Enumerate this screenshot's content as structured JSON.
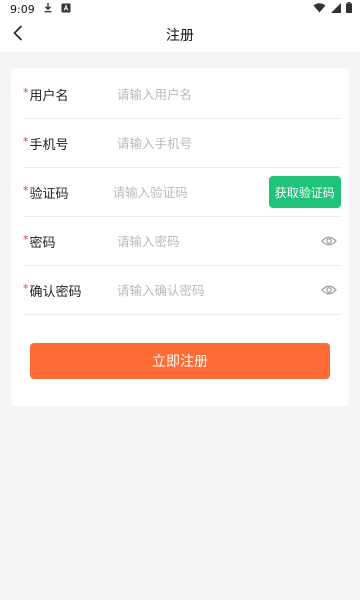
{
  "status_bar": {
    "time": "9:09",
    "icons": [
      "download-icon",
      "notification-icon",
      "wifi-icon",
      "signal-icon",
      "battery-icon"
    ]
  },
  "nav": {
    "title": "注册",
    "back_icon": "chevron-left-icon"
  },
  "form": {
    "required_mark": "*",
    "fields": [
      {
        "label": "用户名",
        "placeholder": "请输入用户名",
        "value": ""
      },
      {
        "label": "手机号",
        "placeholder": "请输入手机号",
        "value": ""
      },
      {
        "label": "验证码",
        "placeholder": "请输入验证码",
        "value": ""
      },
      {
        "label": "密码",
        "placeholder": "请输入密码",
        "value": ""
      },
      {
        "label": "确认密码",
        "placeholder": "请输入确认密码",
        "value": ""
      }
    ],
    "get_code_label": "获取验证码",
    "submit_label": "立即注册"
  },
  "colors": {
    "accent": "#ff6b35",
    "code_button": "#21c27a",
    "required": "#e53935",
    "placeholder": "#b9b9be"
  }
}
